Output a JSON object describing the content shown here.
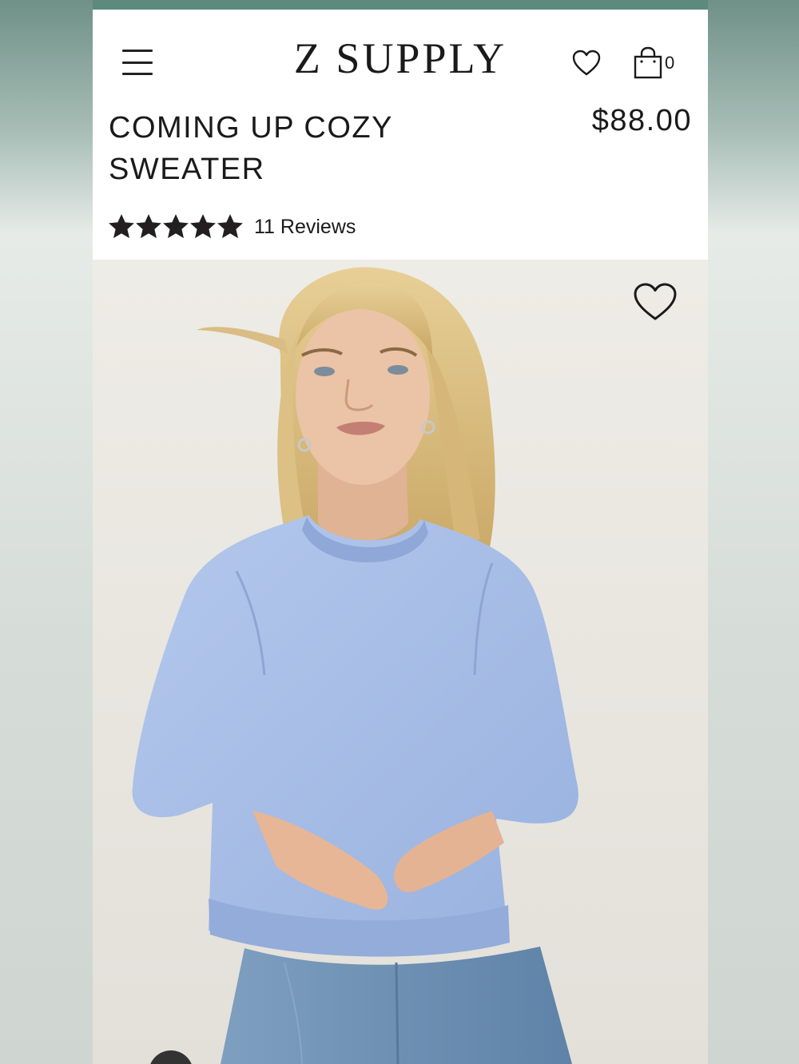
{
  "header": {
    "logo": "Z SUPPLY",
    "bag_count": "0",
    "icons": [
      "menu-icon",
      "heart-icon",
      "shopping-bag-icon"
    ]
  },
  "product": {
    "title": "COMING UP COZY SWEATER",
    "price": "$88.00",
    "rating": 5,
    "rating_max": 5,
    "reviews_label": "11 Reviews"
  },
  "colors": {
    "top_strip": "#5d8a7c",
    "sweater": "#a9bfe6",
    "denim": "#6f93b6"
  }
}
